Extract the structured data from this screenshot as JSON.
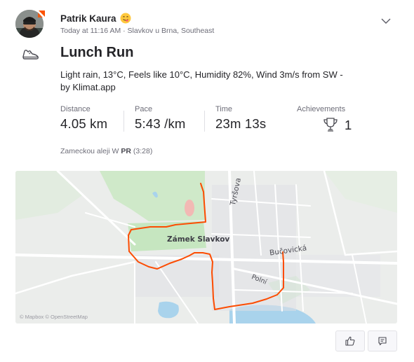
{
  "header": {
    "athlete_name": "Patrik Kaura",
    "timestamp": "Today at 11:16 AM",
    "separator": "·",
    "location": "Slavkov u Brna, Southeast",
    "avatar_icon": "avatar-photo",
    "badge_icon": "subscriber-badge-icon",
    "badge_color": "#fc5200",
    "emoji": "face-savoring-food-emoji",
    "menu_icon": "chevron-down-icon"
  },
  "activity": {
    "sport_icon": "shoe-icon",
    "title": "Lunch Run",
    "description": "Light rain, 13°C, Feels like 10°C, Humidity 82%, Wind 3m/s from SW - by Klimat.app"
  },
  "stats": [
    {
      "label": "Distance",
      "value": "4.05 km"
    },
    {
      "label": "Pace",
      "value": "5:43 /km"
    },
    {
      "label": "Time",
      "value": "23m 13s"
    },
    {
      "label": "Achievements",
      "value": "1",
      "icon": "trophy-icon"
    }
  ],
  "segment": {
    "name": "Zameckou aleji W",
    "badge": "PR",
    "time": "(3:28)"
  },
  "map": {
    "labels": {
      "landmark": "Zámek Slavkov",
      "street_tyrsova": "Tyršova",
      "street_bucovicka": "Bučovická",
      "street_polni": "Polní"
    },
    "attribution": "© Mapbox © OpenStreetMap",
    "route_color": "#fc4c02",
    "park_color": "#c6e6c0",
    "water_color": "#a9d3ec"
  },
  "actions": {
    "kudos_icon": "thumbs-up-icon",
    "comment_icon": "comment-icon"
  }
}
